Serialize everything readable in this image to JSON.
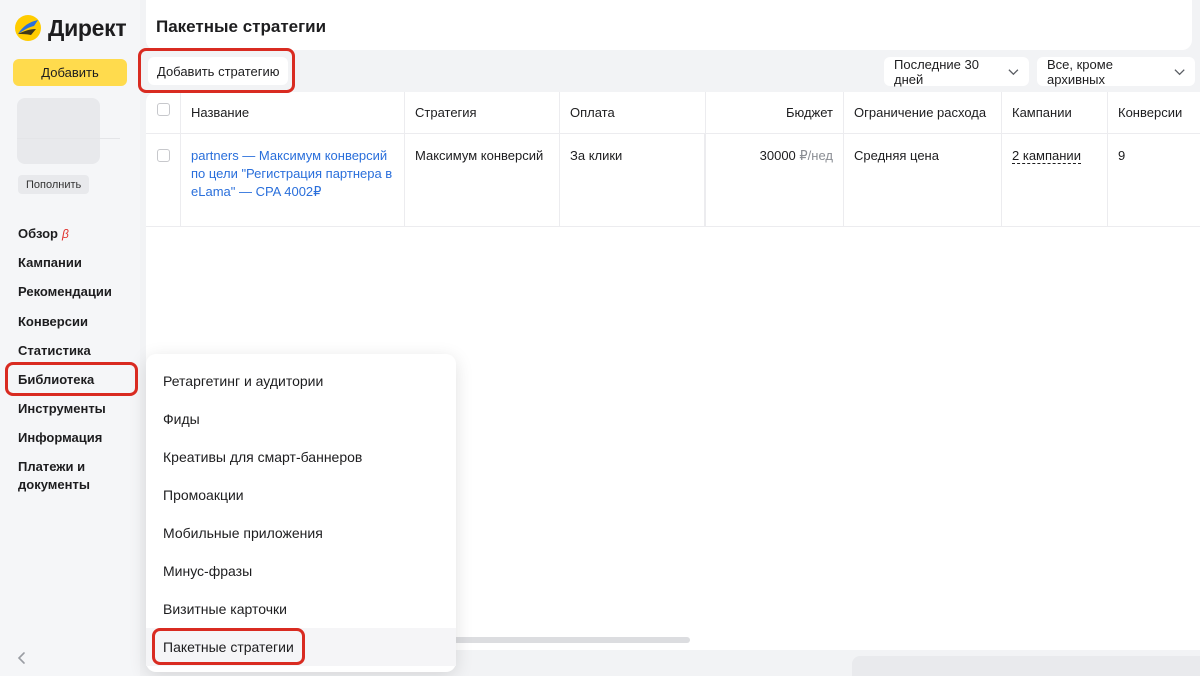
{
  "sidebar": {
    "logo_text": "Директ",
    "add_label": "Добавить",
    "topup_label": "Пополнить",
    "nav": [
      {
        "label": "Обзор",
        "badge": "β"
      },
      {
        "label": "Кампании"
      },
      {
        "label": "Рекомендации"
      },
      {
        "label": "Конверсии"
      },
      {
        "label": "Статистика"
      },
      {
        "label": "Библиотека"
      },
      {
        "label": "Инструменты"
      },
      {
        "label": "Информация"
      },
      {
        "label": "Платежи и документы"
      }
    ],
    "collapse_icon": "chevron-left-icon"
  },
  "header": {
    "title": "Пакетные стратегии"
  },
  "toolbar": {
    "add_strategy_label": "Добавить стратегию",
    "period_select": "Последние 30 дней",
    "archive_select": "Все, кроме архивных"
  },
  "table": {
    "columns": [
      "Название",
      "Стратегия",
      "Оплата",
      "Бюджет",
      "Ограничение расхода",
      "Кампании",
      "Конверсии"
    ],
    "rows": [
      {
        "name": "partners — Максимум конверсий по цели \"Регистрация партнера в eLama\" — CPA 4002₽",
        "strategy": "Максимум конверсий",
        "payment": "За клики",
        "budget_value": "30000",
        "budget_unit": "₽/нед",
        "limit": "Средняя цена",
        "campaigns": "2 кампании",
        "conversions": "9"
      }
    ]
  },
  "library_menu": {
    "items": [
      "Ретаргетинг и аудитории",
      "Фиды",
      "Креативы для смарт-баннеров",
      "Промоакции",
      "Мобильные приложения",
      "Минус-фразы",
      "Визитные карточки",
      "Пакетные стратегии"
    ],
    "active_item": "Пакетные стратегии"
  },
  "colors": {
    "accent_yellow": "#ffdb4d",
    "link_blue": "#2a6fdb",
    "highlight_red": "#d92b21",
    "beta_red": "#e0322e"
  }
}
